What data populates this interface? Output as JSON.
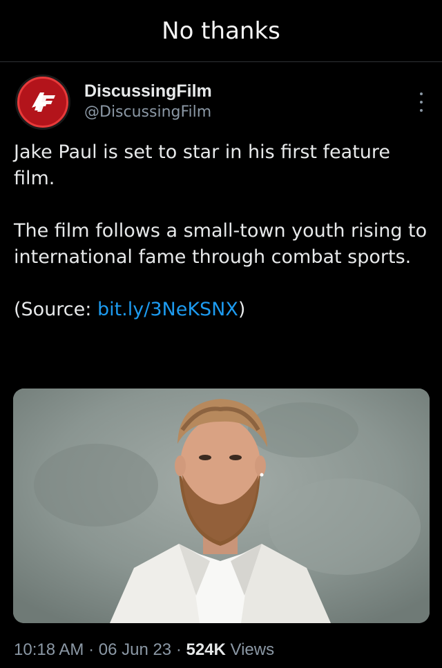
{
  "top_bar": {
    "label": "No thanks"
  },
  "tweet": {
    "author": {
      "display_name": "DiscussingFilm",
      "handle": "@DiscussingFilm",
      "avatar_icon": "discussingfilm-logo-icon",
      "avatar_color": "#b3141b"
    },
    "text": {
      "line1": "Jake Paul is set to star in his first feature film.",
      "line2": "The film follows a small-town youth rising to international fame through combat sports.",
      "source_prefix": "(Source: ",
      "source_link": "bit.ly/3NeKSNX",
      "source_suffix": ")"
    },
    "media": {
      "description_icon": "photo-image"
    },
    "meta": {
      "time": "10:18 AM",
      "sep1": " · ",
      "date": "06 Jun 23",
      "sep2": " · ",
      "views_count": "524K",
      "views_label": " Views"
    }
  },
  "colors": {
    "link": "#1d9bf0",
    "background": "#000000",
    "muted": "#8b98a5"
  }
}
